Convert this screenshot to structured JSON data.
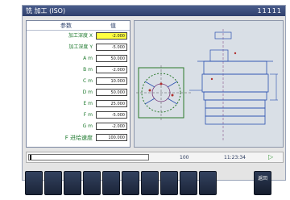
{
  "title": "铣 加工 (ISO)",
  "title_code": "11111",
  "param_header": [
    "参数",
    "值"
  ],
  "params": [
    {
      "label": "加工深度 X",
      "value": "-2.000",
      "active": true
    },
    {
      "label": "加工深度 Y",
      "value": "-5.000",
      "active": false
    },
    {
      "label": "A m",
      "value": "50.000",
      "active": false
    },
    {
      "label": "B m",
      "value": "-2.000",
      "active": false
    },
    {
      "label": "C m",
      "value": "10.000",
      "active": false
    },
    {
      "label": "D m",
      "value": "50.000",
      "active": false
    },
    {
      "label": "E m",
      "value": "25.000",
      "active": false
    },
    {
      "label": "F m",
      "value": "-5.000",
      "active": false
    },
    {
      "label": "G m",
      "value": "-2.000",
      "active": false
    },
    {
      "label": "F 进给速度",
      "value": "100.000",
      "active": false
    }
  ],
  "status": {
    "left": "100",
    "time": "11:23:34",
    "indicator": "▷"
  },
  "softkeys": [
    "",
    "",
    "",
    "",
    "",
    "",
    "",
    "",
    "",
    "",
    "返回"
  ],
  "colors": {
    "title_bg": "#3a4b78",
    "label_green": "#1f7a2f",
    "active_field": "#ffff40",
    "softkey": "#26314a"
  }
}
